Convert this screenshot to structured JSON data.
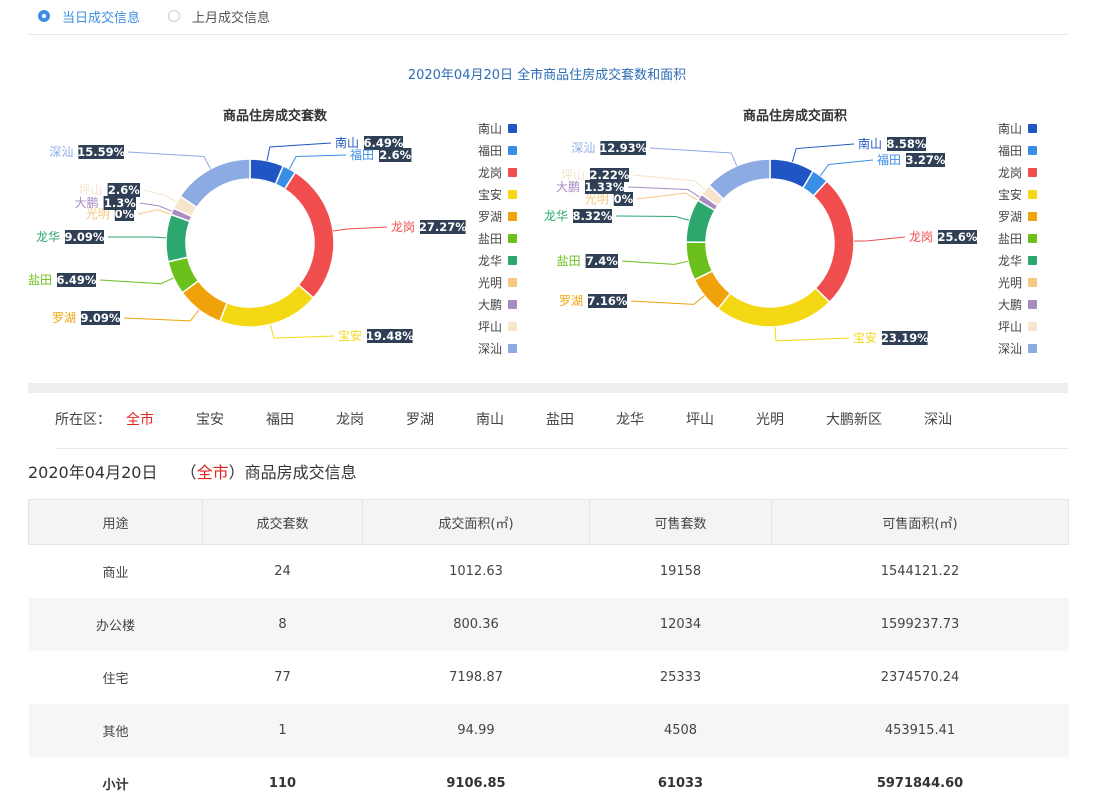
{
  "tabs": [
    {
      "label": "当日成交信息",
      "selected": true
    },
    {
      "label": "上月成交信息",
      "selected": false
    }
  ],
  "main_title": "2020年04月20日 全市商品住房成交套数和面积",
  "colors": {
    "南山": "#1f56c3",
    "福田": "#3a8ee6",
    "龙岗": "#f04e4e",
    "宝安": "#f5d814",
    "罗湖": "#f0a20b",
    "盐田": "#6bc01c",
    "龙华": "#2ca86e",
    "光明": "#f6c784",
    "大鹏": "#a78cc2",
    "坪山": "#f6e4cc",
    "深汕": "#8cabe3"
  },
  "legend_items": [
    "南山",
    "福田",
    "龙岗",
    "宝安",
    "罗湖",
    "盐田",
    "龙华",
    "光明",
    "大鹏",
    "坪山",
    "深汕"
  ],
  "chart_data": [
    {
      "type": "pie",
      "title": "商品住房成交套数",
      "categories": [
        "南山",
        "福田",
        "龙岗",
        "宝安",
        "罗湖",
        "盐田",
        "龙华",
        "光明",
        "大鹏",
        "坪山",
        "深汕"
      ],
      "values": [
        6.49,
        2.6,
        27.27,
        19.48,
        9.09,
        6.49,
        9.09,
        0,
        1.3,
        2.6,
        15.59
      ],
      "labels": [
        "6.49%",
        "2.6%",
        "27.27%",
        "19.48%",
        "9.09%",
        "6.49%",
        "9.09%",
        "0%",
        "1.3%",
        "2.6%",
        "15.59%"
      ],
      "legend": "right"
    },
    {
      "type": "pie",
      "title": "商品住房成交面积",
      "categories": [
        "南山",
        "福田",
        "龙岗",
        "宝安",
        "罗湖",
        "盐田",
        "龙华",
        "光明",
        "大鹏",
        "坪山",
        "深汕"
      ],
      "values": [
        8.58,
        3.27,
        25.6,
        23.19,
        7.16,
        7.4,
        8.32,
        0,
        1.33,
        2.22,
        12.93
      ],
      "labels": [
        "8.58%",
        "3.27%",
        "25.6%",
        "23.19%",
        "7.16%",
        "7.4%",
        "8.32%",
        "0%",
        "1.33%",
        "2.22%",
        "12.93%"
      ],
      "legend": "right"
    }
  ],
  "district_filter": {
    "lead": "所在区：",
    "items": [
      {
        "label": "全市",
        "selected": true
      },
      {
        "label": "宝安",
        "selected": false
      },
      {
        "label": "福田",
        "selected": false
      },
      {
        "label": "龙岗",
        "selected": false
      },
      {
        "label": "罗湖",
        "selected": false
      },
      {
        "label": "南山",
        "selected": false
      },
      {
        "label": "盐田",
        "selected": false
      },
      {
        "label": "龙华",
        "selected": false
      },
      {
        "label": "坪山",
        "selected": false
      },
      {
        "label": "光明",
        "selected": false
      },
      {
        "label": "大鹏新区",
        "selected": false
      },
      {
        "label": "深汕",
        "selected": false
      }
    ]
  },
  "table_title": {
    "date": "2020年04月20日",
    "open": "（",
    "district": "全市",
    "close": "）",
    "suffix": "商品房成交信息"
  },
  "table": {
    "headers": [
      "用途",
      "成交套数",
      "成交面积(㎡)",
      "可售套数",
      "可售面积(㎡)"
    ],
    "rows": [
      [
        "商业",
        "24",
        "1012.63",
        "19158",
        "1544121.22"
      ],
      [
        "办公楼",
        "8",
        "800.36",
        "12034",
        "1599237.73"
      ],
      [
        "住宅",
        "77",
        "7198.87",
        "25333",
        "2374570.24"
      ],
      [
        "其他",
        "1",
        "94.99",
        "4508",
        "453915.41"
      ],
      [
        "小计",
        "110",
        "9106.85",
        "61033",
        "5971844.60"
      ]
    ]
  }
}
